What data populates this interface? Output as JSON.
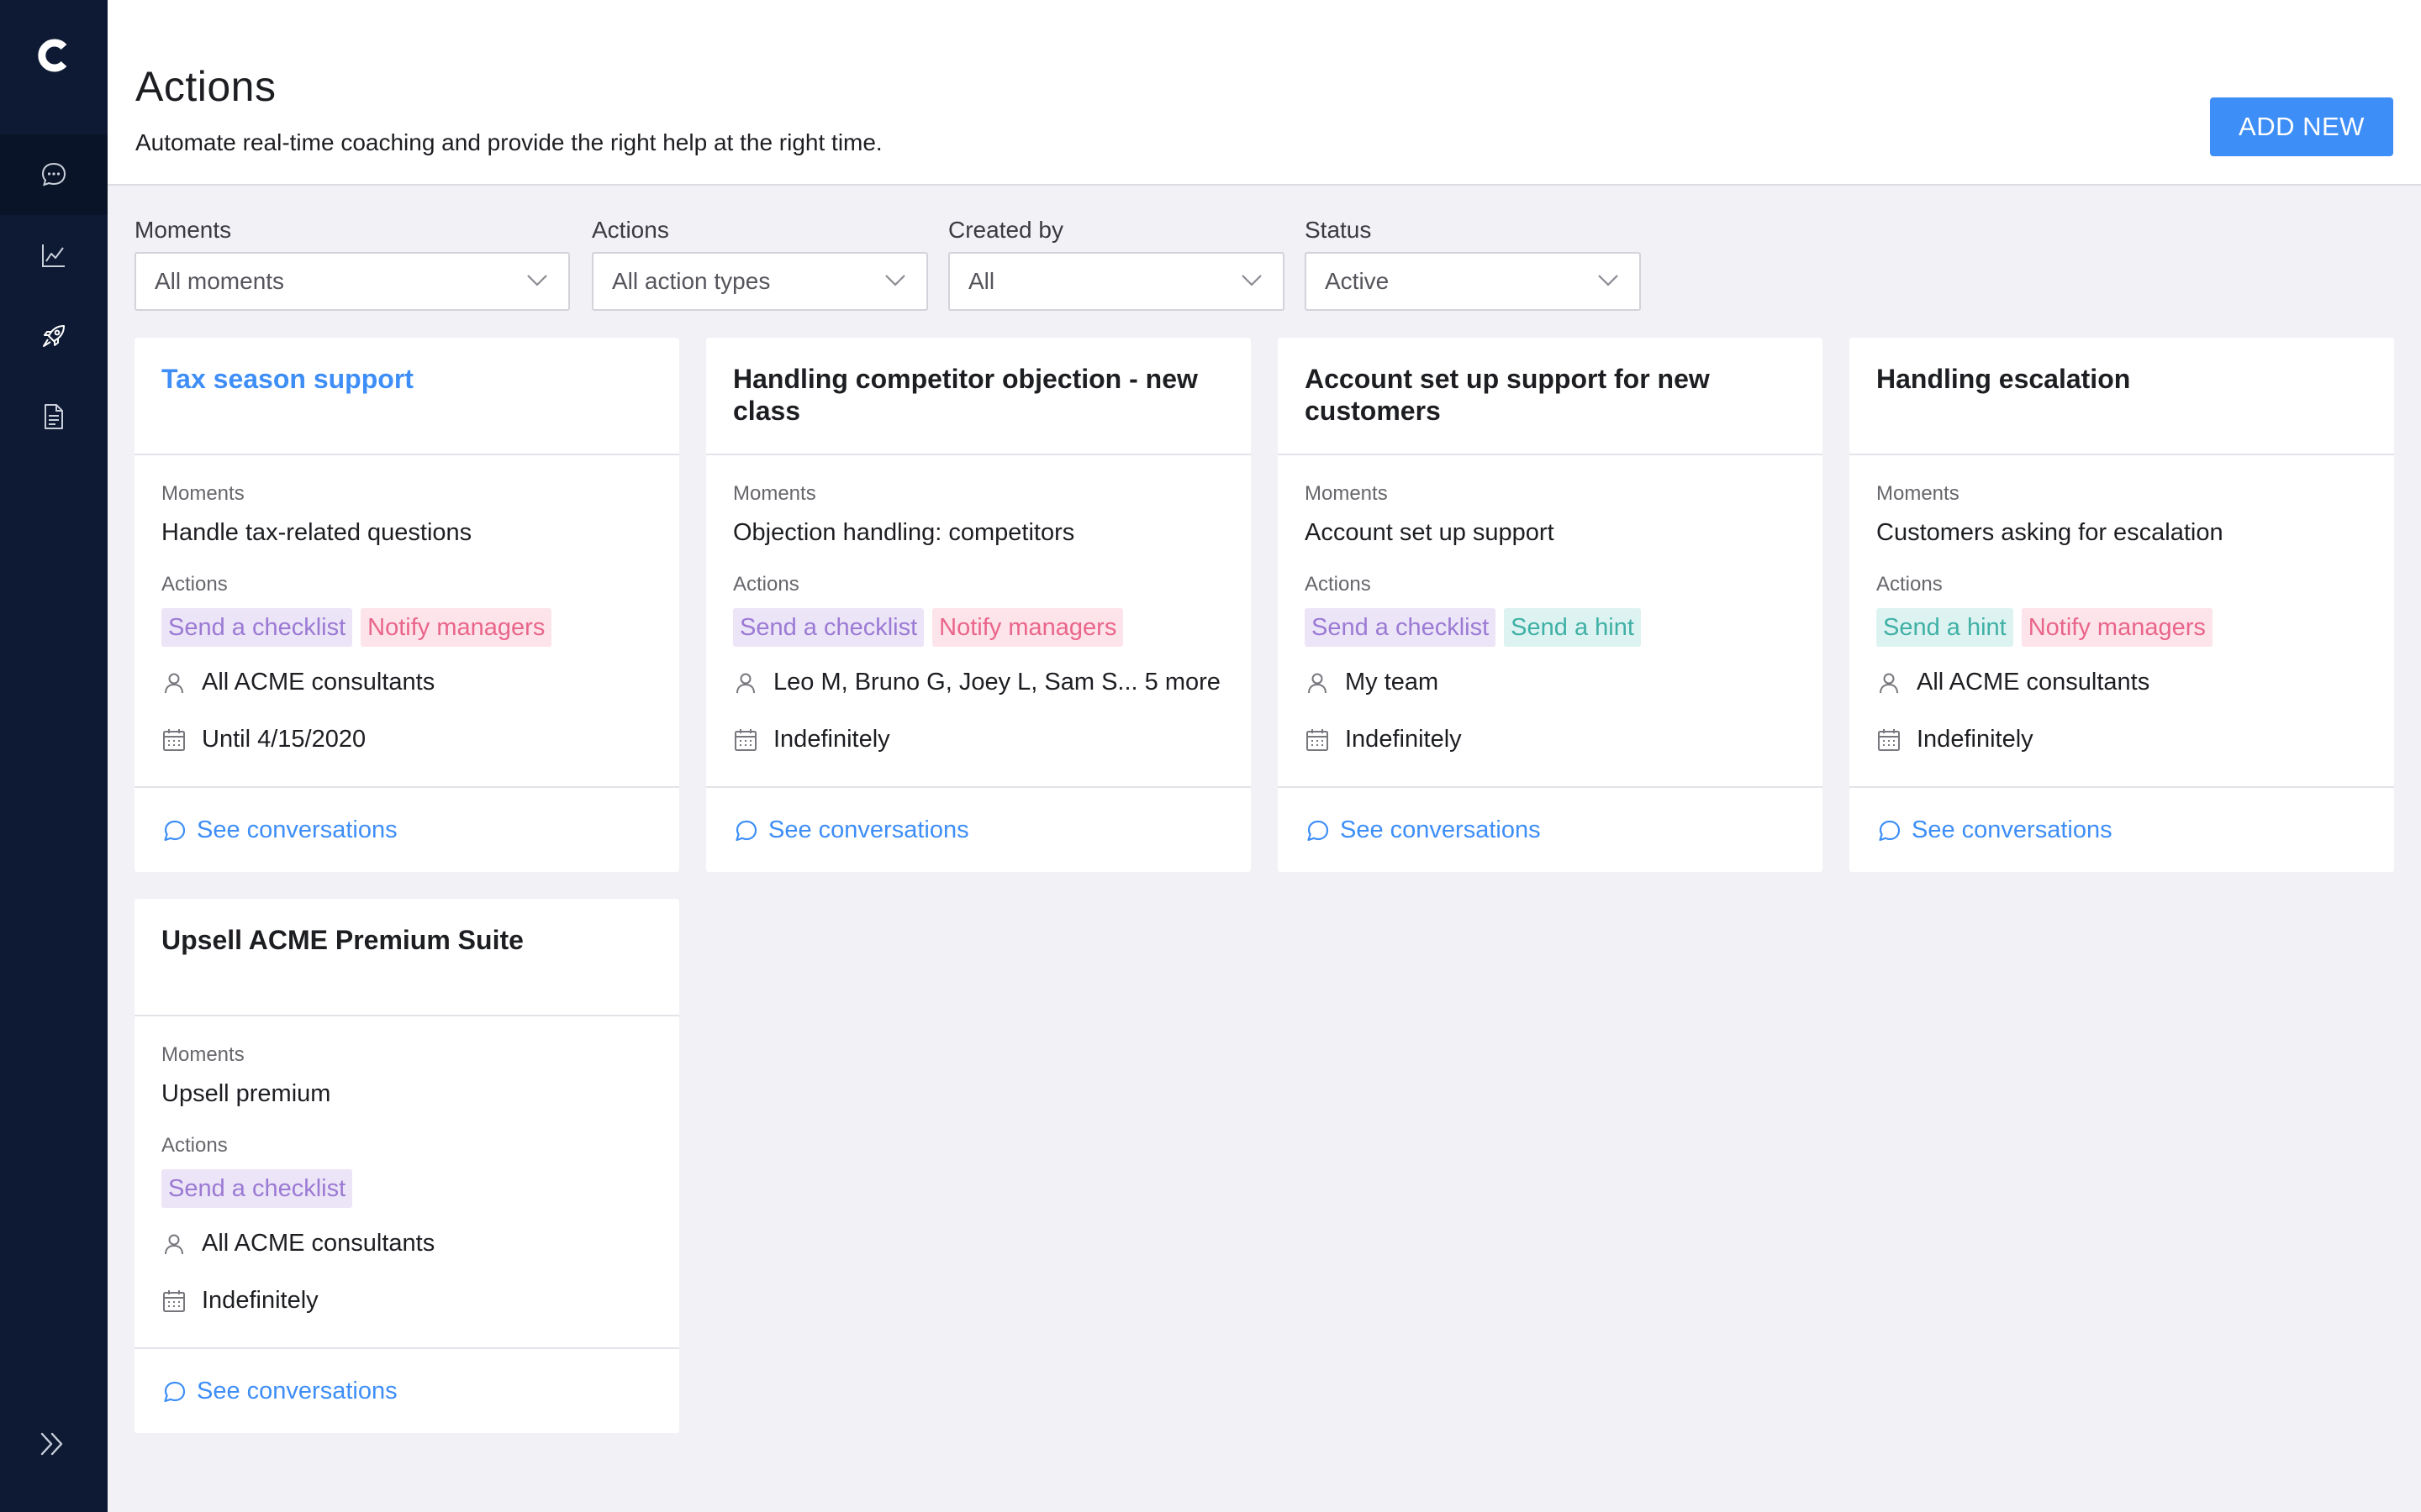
{
  "app": {
    "logo_letter": "C"
  },
  "sidebar": {
    "items": [
      {
        "icon": "chat-bubble-icon",
        "active": true
      },
      {
        "icon": "chart-line-icon",
        "active": false
      },
      {
        "icon": "rocket-icon",
        "active": false
      },
      {
        "icon": "document-icon",
        "active": false
      }
    ],
    "expand_icon": "double-chevron-right-icon"
  },
  "header": {
    "title": "Actions",
    "subtitle": "Automate real-time coaching and provide the right help at the right time.",
    "add_button": "ADD NEW"
  },
  "filters": [
    {
      "label": "Moments",
      "value": "All moments"
    },
    {
      "label": "Actions",
      "value": "All action types"
    },
    {
      "label": "Created by",
      "value": "All"
    },
    {
      "label": "Status",
      "value": "Active"
    }
  ],
  "colors": {
    "accent": "#3e8ef7",
    "sidebar": "#0e1a33",
    "tag_checklist_bg": "#ece4f7",
    "tag_checklist_fg": "#9b7ad4",
    "tag_notify_bg": "#fde4ea",
    "tag_notify_fg": "#e9658a",
    "tag_hint_bg": "#ddf3f1",
    "tag_hint_fg": "#3fb0a6"
  },
  "cards": [
    {
      "title_line1": "Tax season support",
      "title_line2": "",
      "title_is_link": true,
      "moments_label": "Moments",
      "moments": "Handle tax-related questions",
      "actions_label": "Actions",
      "tag1": "Send a checklist",
      "tag2": "Notify managers",
      "audience": "All ACME consultants",
      "duration": "Until 4/15/2020",
      "see": "See conversations"
    },
    {
      "title_line1": "Handling competitor objection - new",
      "title_line2": "class",
      "title_is_link": false,
      "moments_label": "Moments",
      "moments": "Objection handling: competitors",
      "actions_label": "Actions",
      "tag1": "Send a checklist",
      "tag2": "Notify managers",
      "audience": "Leo M, Bruno G, Joey L, Sam S... 5 more",
      "duration": "Indefinitely",
      "see": "See conversations"
    },
    {
      "title_line1": "Account set up support for new",
      "title_line2": "customers",
      "title_is_link": false,
      "moments_label": "Moments",
      "moments": "Account set up support",
      "actions_label": "Actions",
      "tag1": "Send a checklist",
      "tag2": "Send a hint",
      "audience": "My team",
      "duration": "Indefinitely",
      "see": "See conversations"
    },
    {
      "title_line1": "Handling escalation",
      "title_line2": "",
      "title_is_link": false,
      "moments_label": "Moments",
      "moments": "Customers asking for escalation",
      "actions_label": "Actions",
      "tag1": "Send a hint",
      "tag2": "Notify managers",
      "audience": "All ACME consultants",
      "duration": "Indefinitely",
      "see": "See conversations"
    },
    {
      "title_line1": "Upsell ACME Premium Suite",
      "title_line2": "",
      "title_is_link": false,
      "moments_label": "Moments",
      "moments": "Upsell premium",
      "actions_label": "Actions",
      "tag1": "Send a checklist",
      "audience": "All ACME consultants",
      "duration": "Indefinitely",
      "see": "See conversations"
    }
  ]
}
